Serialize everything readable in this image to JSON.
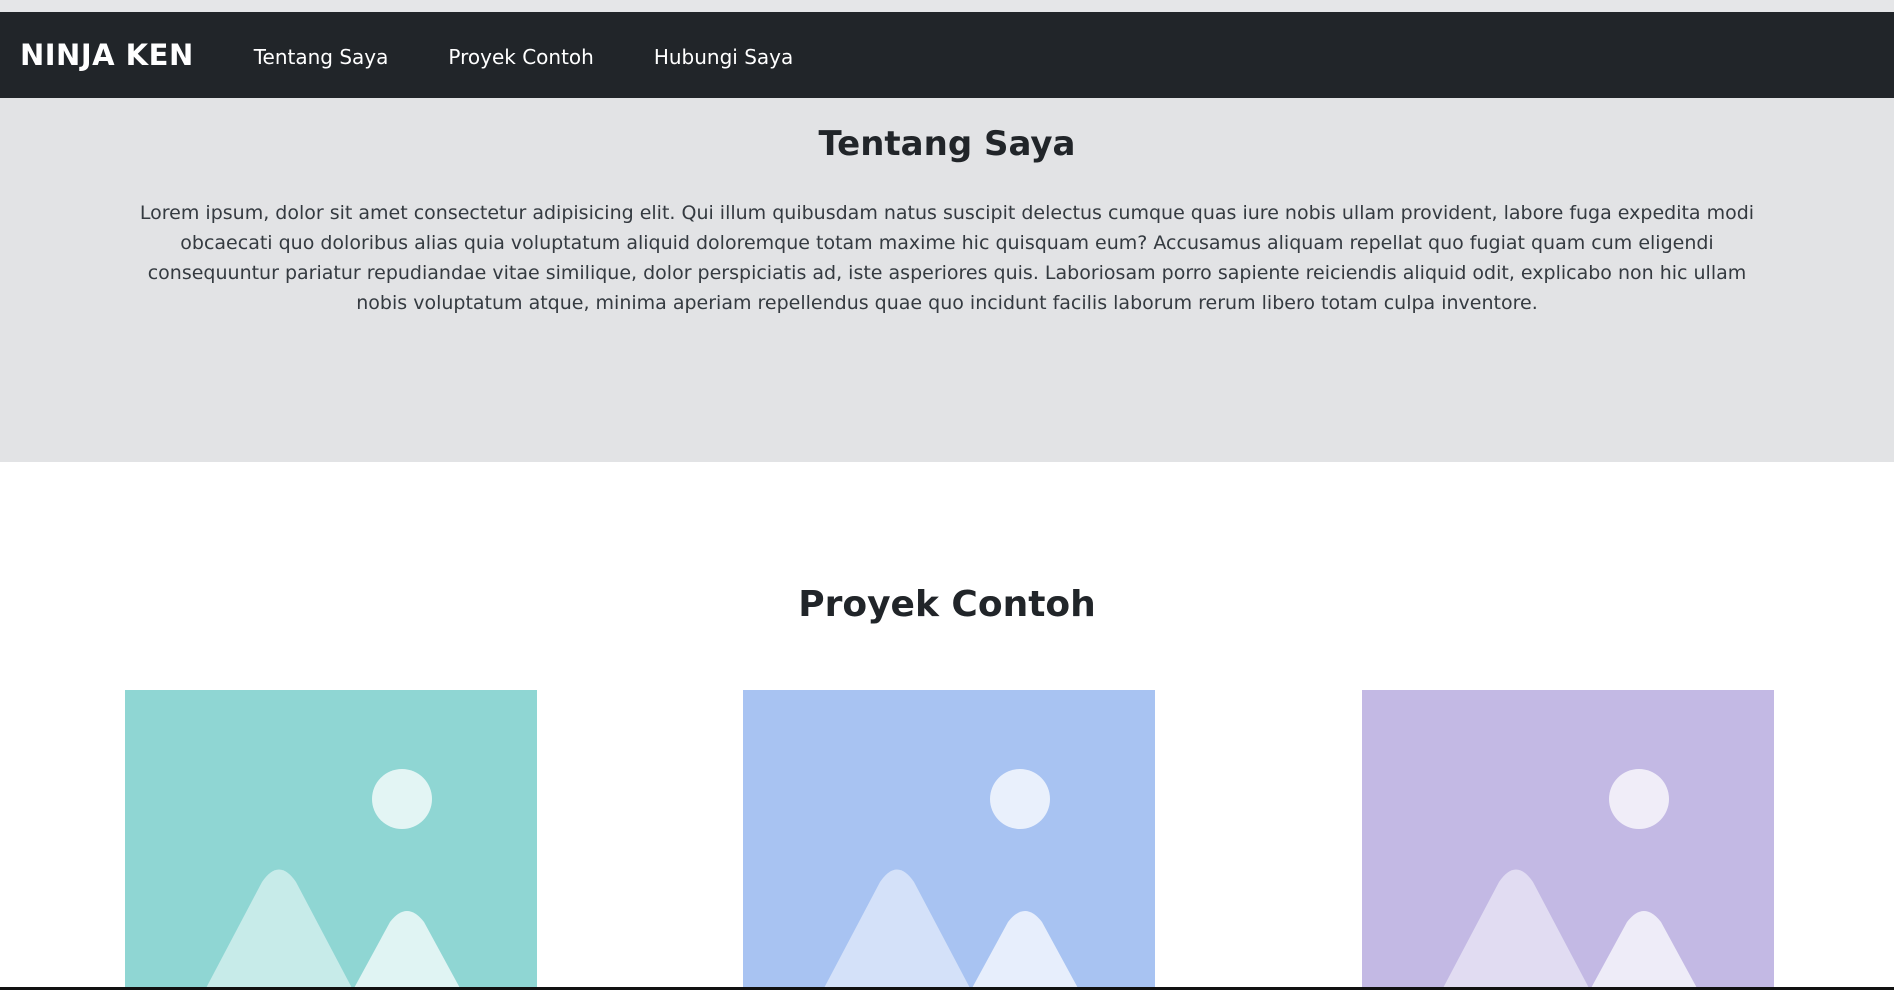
{
  "navbar": {
    "brand": "NINJA KEN",
    "links": [
      {
        "label": "Tentang Saya"
      },
      {
        "label": "Proyek Contoh"
      },
      {
        "label": "Hubungi Saya"
      }
    ]
  },
  "about": {
    "title": "Tentang Saya",
    "text": "Lorem ipsum, dolor sit amet consectetur adipisicing elit. Qui illum quibusdam natus suscipit delectus cumque quas iure nobis ullam provident, labore fuga expedita modi obcaecati quo doloribus alias quia voluptatum aliquid doloremque totam maxime hic quisquam eum? Accusamus aliquam repellat quo fugiat quam cum eligendi consequuntur pariatur repudiandae vitae similique, dolor perspiciatis ad, iste asperiores quis. Laboriosam porro sapiente reiciendis aliquid odit, explicabo non hic ullam nobis voluptatum atque, minima aperiam repellendus quae quo incidunt facilis laborum rerum libero totam culpa inventore."
  },
  "projects": {
    "title": "Proyek Contoh",
    "cards": [
      {
        "icon": "image-placeholder-icon",
        "color": "#8fd6d3"
      },
      {
        "icon": "image-placeholder-icon",
        "color": "#a8c3f2"
      },
      {
        "icon": "image-placeholder-icon",
        "color": "#c3b9e4"
      }
    ]
  }
}
